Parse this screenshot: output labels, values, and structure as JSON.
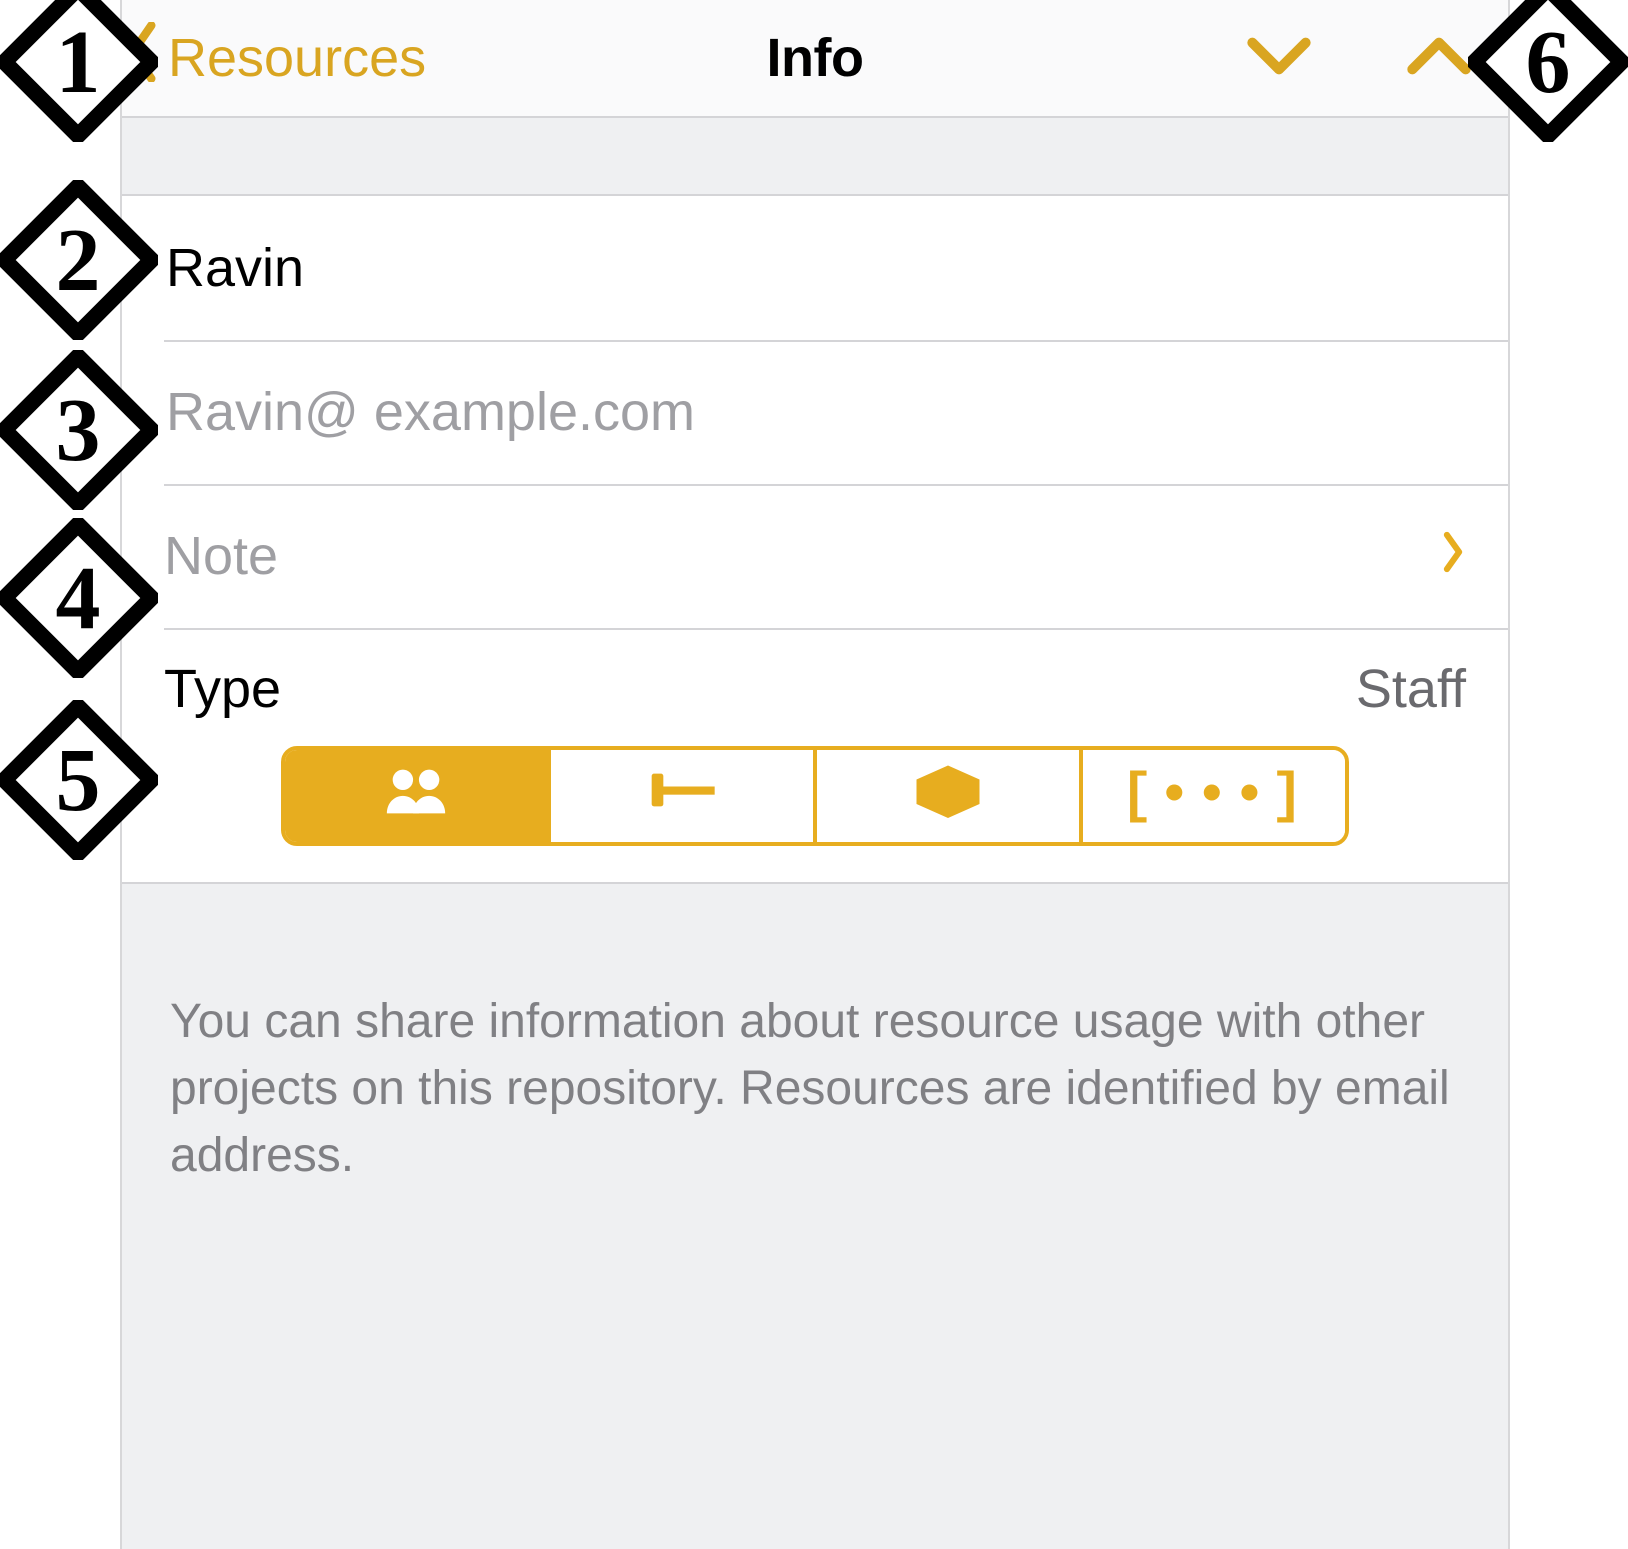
{
  "accent_color": "#d9a521",
  "navbar": {
    "back_label": "Resources",
    "title": "Info"
  },
  "fields": {
    "name_value": "Ravin",
    "email_placeholder": "Ravin@ example.com",
    "note_placeholder": "Note"
  },
  "type": {
    "label": "Type",
    "value": "Staff",
    "segments": {
      "group": "group-icon",
      "gavel": "gavel-icon",
      "box": "box-icon",
      "more": "more-icon"
    }
  },
  "footer": "You can share information about resource usage with other projects on this repository. Resources are identified by email address.",
  "callouts": {
    "c1": "1",
    "c2": "2",
    "c3": "3",
    "c4": "4",
    "c5": "5",
    "c6": "6"
  }
}
